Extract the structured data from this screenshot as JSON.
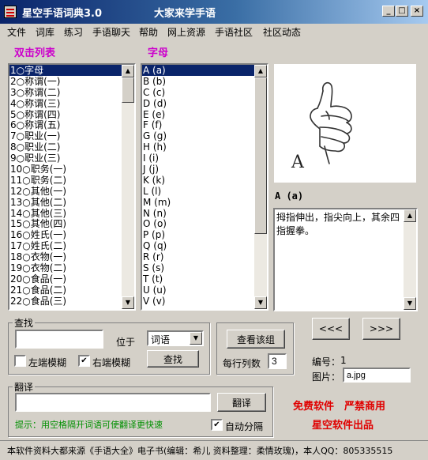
{
  "window": {
    "title": "星空手语词典3.0",
    "slogan": "大家来学手语",
    "minimize": "_",
    "maximize": "□",
    "close": "×"
  },
  "menu": [
    "文件",
    "词库",
    "练习",
    "手语聊天",
    "帮助",
    "网上资源",
    "手语社区",
    "社区动态"
  ],
  "left_list": {
    "label": "双击列表",
    "items": [
      "1○字母",
      "2○称谓(一)",
      "3○称谓(二)",
      "4○称谓(三)",
      "5○称谓(四)",
      "6○称谓(五)",
      "7○职业(一)",
      "8○职业(二)",
      "9○职业(三)",
      "10○职务(一)",
      "11○职务(二)",
      "12○其他(一)",
      "13○其他(二)",
      "14○其他(三)",
      "15○其他(四)",
      "16○姓氏(一)",
      "17○姓氏(二)",
      "18○衣物(一)",
      "19○衣物(二)",
      "20○食品(一)",
      "21○食品(二)",
      "22○食品(三)"
    ],
    "selected_index": 0
  },
  "right_list": {
    "label": "字母",
    "items": [
      "A (a)",
      "B (b)",
      "C (c)",
      "D (d)",
      "E (e)",
      "F (f)",
      "G (g)",
      "H (h)",
      "I (i)",
      "J (j)",
      "K (k)",
      "L (l)",
      "M (m)",
      "N (n)",
      "O (o)",
      "P (p)",
      "Q (q)",
      "R (r)",
      "S (s)",
      "T (t)",
      "U (u)",
      "V (v)"
    ],
    "selected_index": 0
  },
  "preview": {
    "letter": "A",
    "word": "A (a)",
    "description": "拇指伸出，指尖向上，其余四指握拳。"
  },
  "search": {
    "title": "查找",
    "input_value": "",
    "position_label": "位于",
    "scope_value": "词语",
    "fuzzy_left_label": "左端模糊",
    "fuzzy_left_checked": false,
    "fuzzy_right_label": "右端模糊",
    "fuzzy_right_checked": true,
    "find_button": "查找",
    "check_mark": "✔"
  },
  "group": {
    "view_button": "查看该组",
    "columns_label": "每行列数",
    "columns_value": "3"
  },
  "nav": {
    "prev": "<<<",
    "next": ">>>"
  },
  "info": {
    "number_label": "编号：",
    "number_value": "1",
    "image_label": "图片：",
    "image_value": "a.jpg"
  },
  "translate": {
    "title": "翻译",
    "input_value": "",
    "button": "翻译",
    "hint": "提示：用空格隔开词语可使翻译更快速",
    "auto_split_label": "自动分隔",
    "auto_split_checked": true
  },
  "promo": {
    "line1": "免费软件　严禁商用",
    "line2": "星空软件出品"
  },
  "status": "本软件资料大都来源《手语大全》电子书(编辑：希儿 资料整理：柔情玫瑰)，本人QQ：805335515"
}
